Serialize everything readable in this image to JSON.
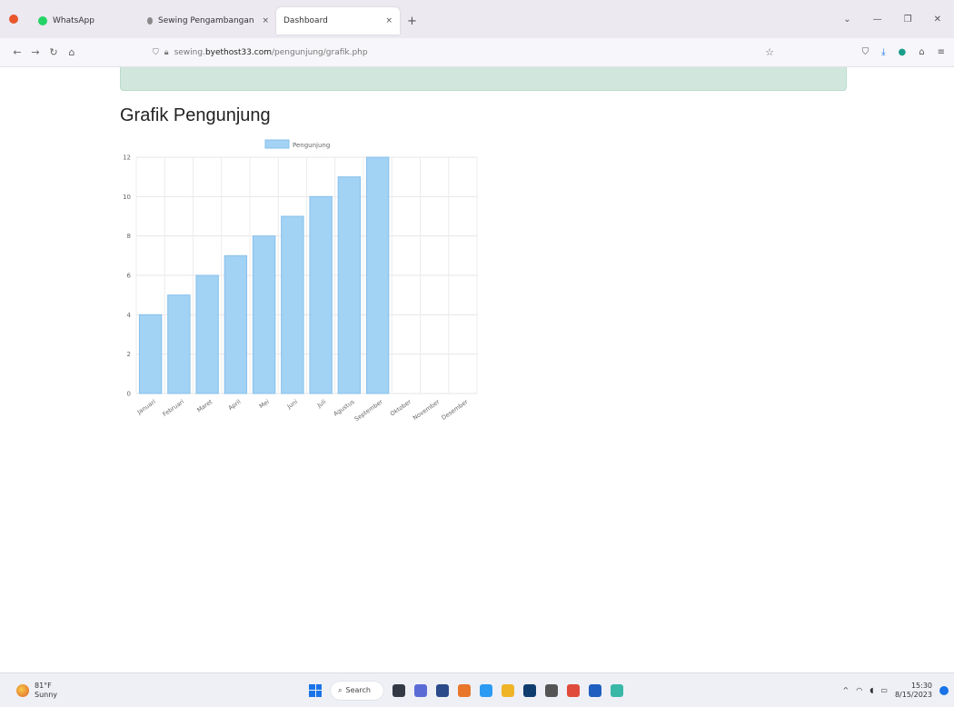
{
  "browser": {
    "tabs": [
      {
        "label": "WhatsApp",
        "color": "#25d366",
        "active": false
      },
      {
        "label": "Sewing Pengambangan Situs Ac",
        "color": "#7a7a7a",
        "active": false
      },
      {
        "label": "Dashboard",
        "color": "#ffffff",
        "active": true
      }
    ],
    "close_glyph": "×",
    "new_tab": "+",
    "window_controls": [
      "⌄",
      "—",
      "❐",
      "✕"
    ],
    "url_prefix": "sewing.",
    "url_domain": "byethost33.com",
    "url_path": "/pengunjung/grafik.php",
    "nav_icons": [
      "back-icon",
      "forward-icon",
      "reload-icon",
      "home-icon"
    ],
    "right_icons": [
      "shield-icon",
      "download-icon",
      "extension-icon",
      "account-icon",
      "menu-icon"
    ]
  },
  "page": {
    "title": "Grafik Pengunjung",
    "alert_color": "#d1e7dd"
  },
  "chart_data": {
    "type": "bar",
    "categories": [
      "Januari",
      "Februari",
      "Maret",
      "April",
      "Mei",
      "Juni",
      "Juli",
      "Agustus",
      "September",
      "Oktober",
      "November",
      "Desember"
    ],
    "series": [
      {
        "name": "Pengunjung",
        "values": [
          4,
          5,
          6,
          7,
          8,
          9,
          10,
          11,
          12,
          null,
          null,
          null
        ],
        "color": "#a2d2f4",
        "border": "#87c0ec"
      }
    ],
    "ylim": [
      0,
      12
    ],
    "yticks": [
      0,
      2,
      4,
      6,
      8,
      10,
      12
    ],
    "grid": true,
    "legend": "top"
  },
  "taskbar": {
    "weather_temp": "81°F",
    "weather_desc": "Sunny",
    "search_label": "Search",
    "time": "15:30",
    "date": "8/15/2023",
    "apps": [
      "#333a45",
      "#5b6bd6",
      "#2a4a8a",
      "#e8762b",
      "#2b9af3",
      "#f0b429",
      "#0f3d6e",
      "#555555",
      "#e04a3a",
      "#1f5fbf",
      "#39b8a8"
    ]
  }
}
